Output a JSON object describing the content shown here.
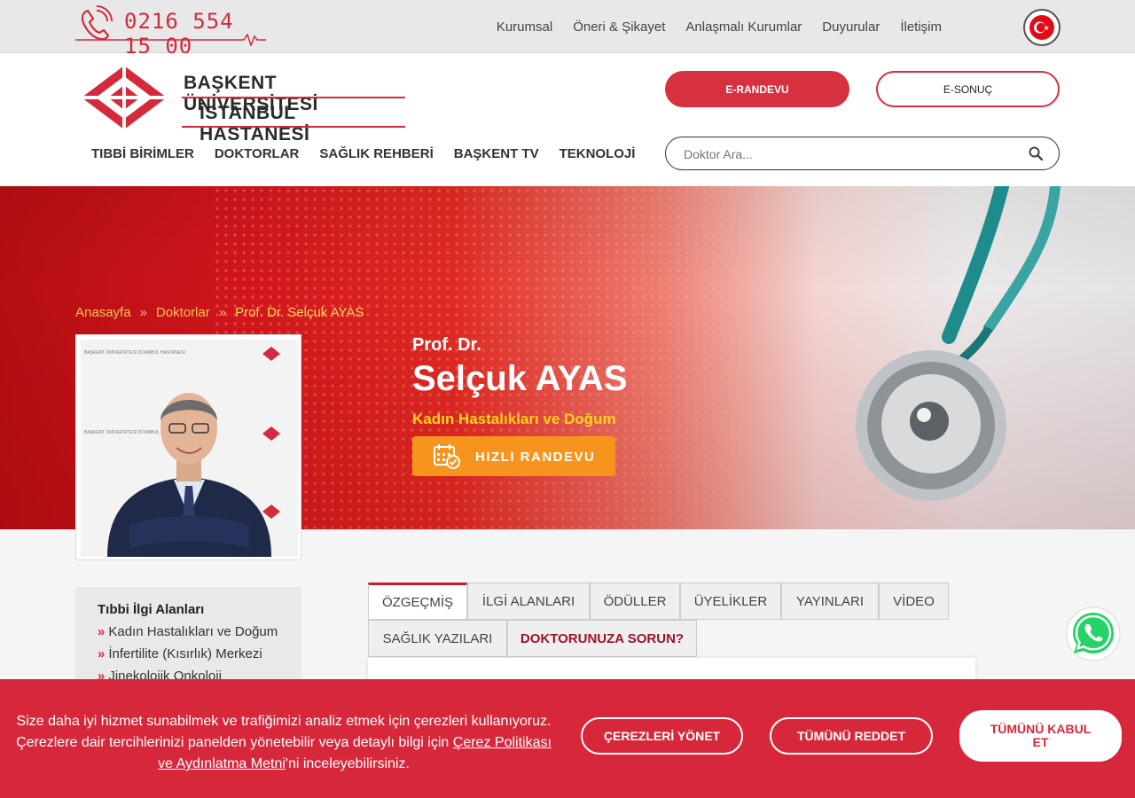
{
  "topbar": {
    "phone": "0216 554 15 00",
    "links": [
      "Kurumsal",
      "Öneri & Şikayet",
      "Anlaşmalı Kurumlar",
      "Duyurular",
      "İletişim"
    ]
  },
  "header": {
    "logo_line1": "BAŞKENT ÜNİVERSİTESİ",
    "logo_line2": "İSTANBUL HASTANESİ",
    "nav": [
      "TIBBİ BİRİMLER",
      "DOKTORLAR",
      "SAĞLIK REHBERİ",
      "BAŞKENT TV",
      "TEKNOLOJİ"
    ],
    "erandevu_label": "E-RANDEVU",
    "esonuc_label": "E-SONUÇ",
    "search_placeholder": "Doktor Ara..."
  },
  "hero": {
    "breadcrumb": [
      "Anasayfa",
      "Doktorlar",
      "Prof. Dr. Selçuk AYAS"
    ],
    "breadcrumb_sep": "»",
    "doctor_title": "Prof. Dr.",
    "doctor_name": "Selçuk AYAS",
    "department": "Kadın Hastalıkları ve Doğum",
    "quick_appointment_label": "HIZLI RANDEVU"
  },
  "photo_backdrop_text": "BAŞKENT ÜNİVERSİTESİ İSTANBUL HASTANESİ",
  "sidebar": {
    "title": "Tıbbi İlgi Alanları",
    "items": [
      "Kadın Hastalıkları ve Doğum",
      "İnfertilite (Kısırlık) Merkezi",
      "Jinekolojik Onkoloji"
    ]
  },
  "tabs": [
    "ÖZGEÇMİŞ",
    "İLGİ ALANLARI",
    "ÖDÜLLER",
    "ÜYELİKLER",
    "YAYINLARI",
    "VİDEO",
    "SAĞLIK YAZILARI",
    "DOKTORUNUZA SORUN?"
  ],
  "cookie": {
    "text_part1": "Size daha iyi hizmet sunabilmek ve trafiğimizi analiz etmek için çerezleri kullanıyoruz. Çerezlere dair tercihlerinizi panelden yönetebilir veya detaylı bilgi için ",
    "link_text": "Çerez Politikası ve Aydınlatma Metni",
    "text_part2": "'ni inceleyebilirsiniz.",
    "manage_label": "ÇEREZLERİ YÖNET",
    "reject_label": "TÜMÜNÜ REDDET",
    "accept_label": "TÜMÜNÜ KABUL ET"
  },
  "colors": {
    "brand_red": "#d7303f",
    "accent_orange": "#f7941d",
    "accent_yellow": "#ffd21c",
    "cookie_bg": "#d7283b"
  }
}
